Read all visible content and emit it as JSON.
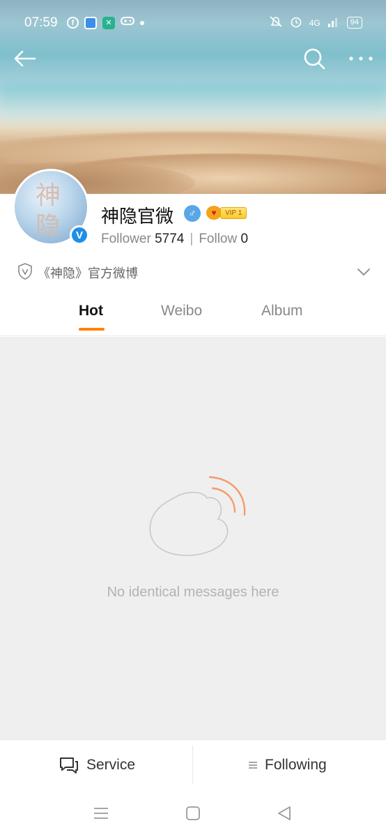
{
  "status_bar": {
    "time": "07:59",
    "network": "4G",
    "battery": "94",
    "icons": [
      "facebook-icon",
      "app-icon",
      "app-icon",
      "gamepad-icon",
      "mute-icon",
      "alarm-icon",
      "signal-icon",
      "battery-icon"
    ]
  },
  "profile": {
    "name": "神隐官微",
    "avatar_text": [
      "神",
      "隐"
    ],
    "verified_glyph": "V",
    "gender_glyph": "♂",
    "vip_label": "VIP 1",
    "follower_label": "Follower",
    "follower_count": "5774",
    "follow_label": "Follow",
    "follow_count": "0",
    "separator": "|",
    "description": "《神隐》官方微博"
  },
  "tabs": [
    {
      "label": "Hot",
      "active": true
    },
    {
      "label": "Weibo",
      "active": false
    },
    {
      "label": "Album",
      "active": false
    }
  ],
  "empty_state": {
    "message": "No identical messages here"
  },
  "action_bar": {
    "service_label": "Service",
    "following_label": "Following"
  },
  "colors": {
    "accent": "#ff8200",
    "verified": "#1f8ee7",
    "background": "#efefef"
  }
}
